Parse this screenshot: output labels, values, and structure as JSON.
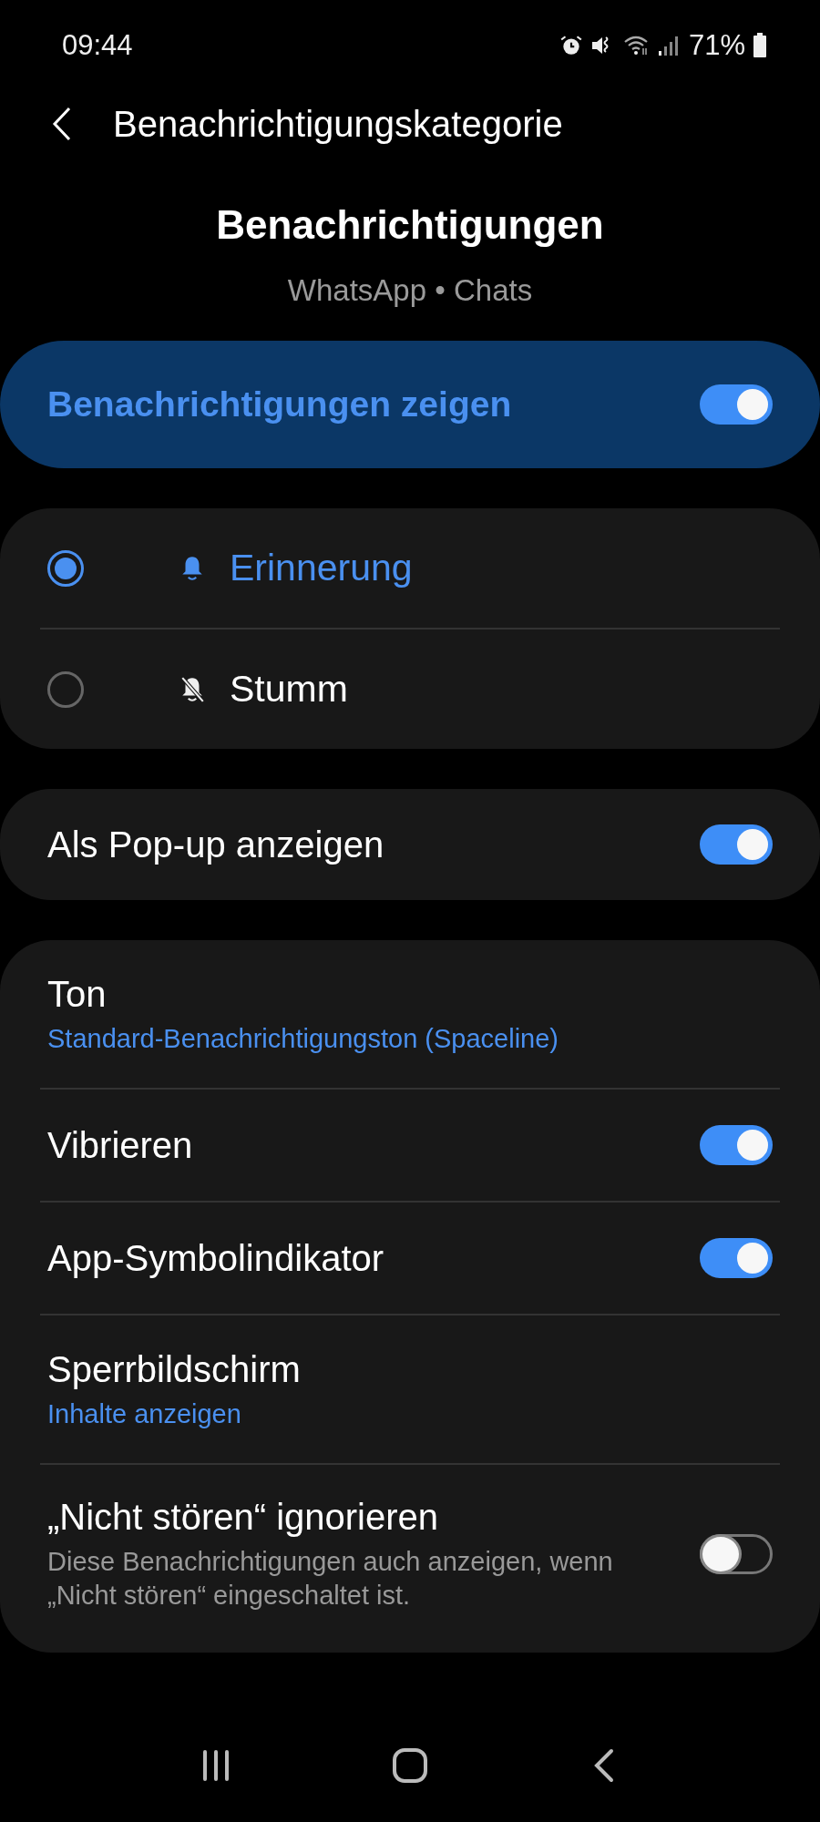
{
  "status_bar": {
    "time": "09:44",
    "battery": "71%"
  },
  "header": {
    "title": "Benachrichtigungskategorie"
  },
  "heading": {
    "title": "Benachrichtigungen",
    "subtitle": "WhatsApp • Chats"
  },
  "master_switch": {
    "label": "Benachrichtigungen zeigen",
    "on": true
  },
  "alert_modes": [
    {
      "label": "Erinnerung",
      "kind": "sound",
      "selected": true
    },
    {
      "label": "Stumm",
      "kind": "silent",
      "selected": false
    }
  ],
  "popup": {
    "label": "Als Pop-up anzeigen",
    "on": true
  },
  "settings": [
    {
      "kind": "value",
      "title": "Ton",
      "value": "Standard-Benachrichtigungston (Spaceline)"
    },
    {
      "kind": "switch",
      "title": "Vibrieren",
      "on": true
    },
    {
      "kind": "switch",
      "title": "App-Symbolindikator",
      "on": true
    },
    {
      "kind": "value",
      "title": "Sperrbildschirm",
      "value": "Inhalte anzeigen"
    },
    {
      "kind": "switch",
      "title": "„Nicht stören“ ignorieren",
      "description": "Diese Benachrichtigungen auch anzeigen, wenn „Nicht stören“ eingeschaltet ist.",
      "on": false
    }
  ]
}
